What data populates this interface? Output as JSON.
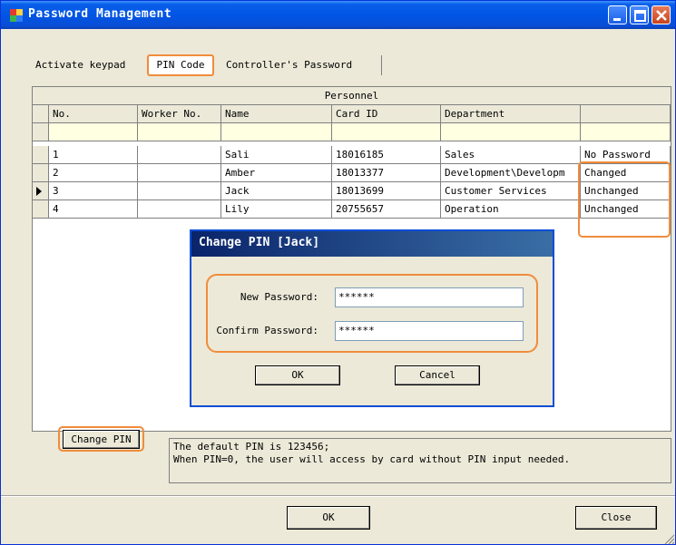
{
  "window": {
    "title": "Password Management",
    "accent_color": "#0055e5",
    "highlight_color": "#f08c3c"
  },
  "tabs": [
    "Activate keypad",
    "PIN Code",
    "Controller's Password"
  ],
  "grid": {
    "title": "Personnel",
    "columns": [
      "No.",
      "Worker No.",
      "Name",
      "Card ID",
      "Department",
      ""
    ],
    "rows": [
      {
        "no": "1",
        "worker_no": "",
        "name": "Sali",
        "card_id": "18016185",
        "department": "Sales",
        "status": "No Password",
        "selected": false
      },
      {
        "no": "2",
        "worker_no": "",
        "name": "Amber",
        "card_id": "18013377",
        "department": "Development\\Developm",
        "status": "Changed",
        "selected": false
      },
      {
        "no": "3",
        "worker_no": "",
        "name": "Jack",
        "card_id": "18013699",
        "department": "Customer Services",
        "status": "Unchanged",
        "selected": true
      },
      {
        "no": "4",
        "worker_no": "",
        "name": "Lily",
        "card_id": "20755657",
        "department": "Operation",
        "status": "Unchanged",
        "selected": false
      }
    ]
  },
  "dialog": {
    "title": "Change PIN   [Jack]",
    "new_password_label": "New Password:",
    "new_password_value": "******",
    "confirm_password_label": "Confirm Password:",
    "confirm_password_value": "******",
    "ok_label": "OK",
    "cancel_label": "Cancel"
  },
  "change_pin_label": "Change PIN",
  "info": {
    "line1": "The default PIN is 123456;",
    "line2": "When PIN=0, the user will access by card without PIN input needed."
  },
  "bottom": {
    "ok_label": "OK",
    "close_label": "Close"
  }
}
